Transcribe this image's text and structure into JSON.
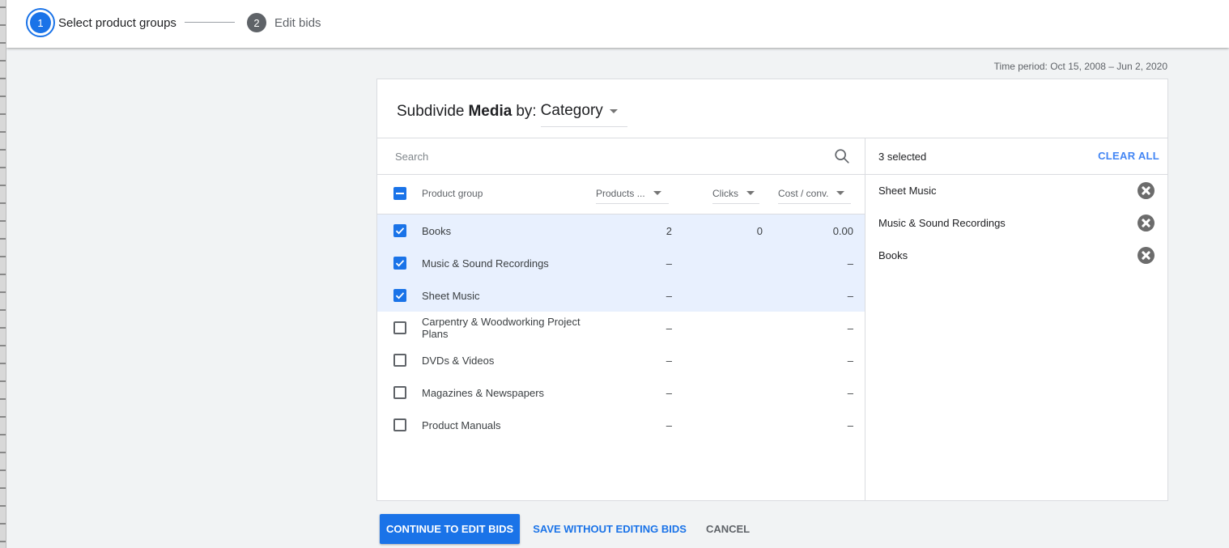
{
  "stepper": {
    "steps": [
      {
        "number": "1",
        "label": "Select product groups",
        "state": "active"
      },
      {
        "number": "2",
        "label": "Edit bids",
        "state": "inactive"
      }
    ]
  },
  "time_period": "Time period: Oct 15, 2008 – Jun 2, 2020",
  "card": {
    "title_prefix": "Subdivide",
    "title_group": "Media",
    "title_by": "by:",
    "dimension": "Category"
  },
  "search": {
    "placeholder": "Search",
    "value": ""
  },
  "table": {
    "columns": {
      "product_group": "Product group",
      "products": "Products ...",
      "clicks": "Clicks",
      "cost_conv": "Cost / conv."
    },
    "header_checkbox_state": "indeterminate",
    "rows": [
      {
        "name": "Books",
        "products": "2",
        "clicks": "0",
        "cost_conv": "0.00",
        "checked": true
      },
      {
        "name": "Music & Sound Recordings",
        "products": "–",
        "clicks": "",
        "cost_conv": "–",
        "checked": true
      },
      {
        "name": "Sheet Music",
        "products": "–",
        "clicks": "",
        "cost_conv": "–",
        "checked": true
      },
      {
        "name": "Carpentry & Woodworking Project Plans",
        "products": "–",
        "clicks": "",
        "cost_conv": "–",
        "checked": false
      },
      {
        "name": "DVDs & Videos",
        "products": "–",
        "clicks": "",
        "cost_conv": "–",
        "checked": false
      },
      {
        "name": "Magazines & Newspapers",
        "products": "–",
        "clicks": "",
        "cost_conv": "–",
        "checked": false
      },
      {
        "name": "Product Manuals",
        "products": "–",
        "clicks": "",
        "cost_conv": "–",
        "checked": false
      }
    ]
  },
  "selection": {
    "count_label": "3 selected",
    "clear_all": "CLEAR ALL",
    "items": [
      "Sheet Music",
      "Music & Sound Recordings",
      "Books"
    ]
  },
  "actions": {
    "continue": "CONTINUE TO EDIT BIDS",
    "save": "SAVE WITHOUT EDITING BIDS",
    "cancel": "CANCEL"
  },
  "colors": {
    "primary": "#1a73e8",
    "selected_row_bg": "#e8f0fe",
    "page_bg": "#f1f3f4"
  }
}
